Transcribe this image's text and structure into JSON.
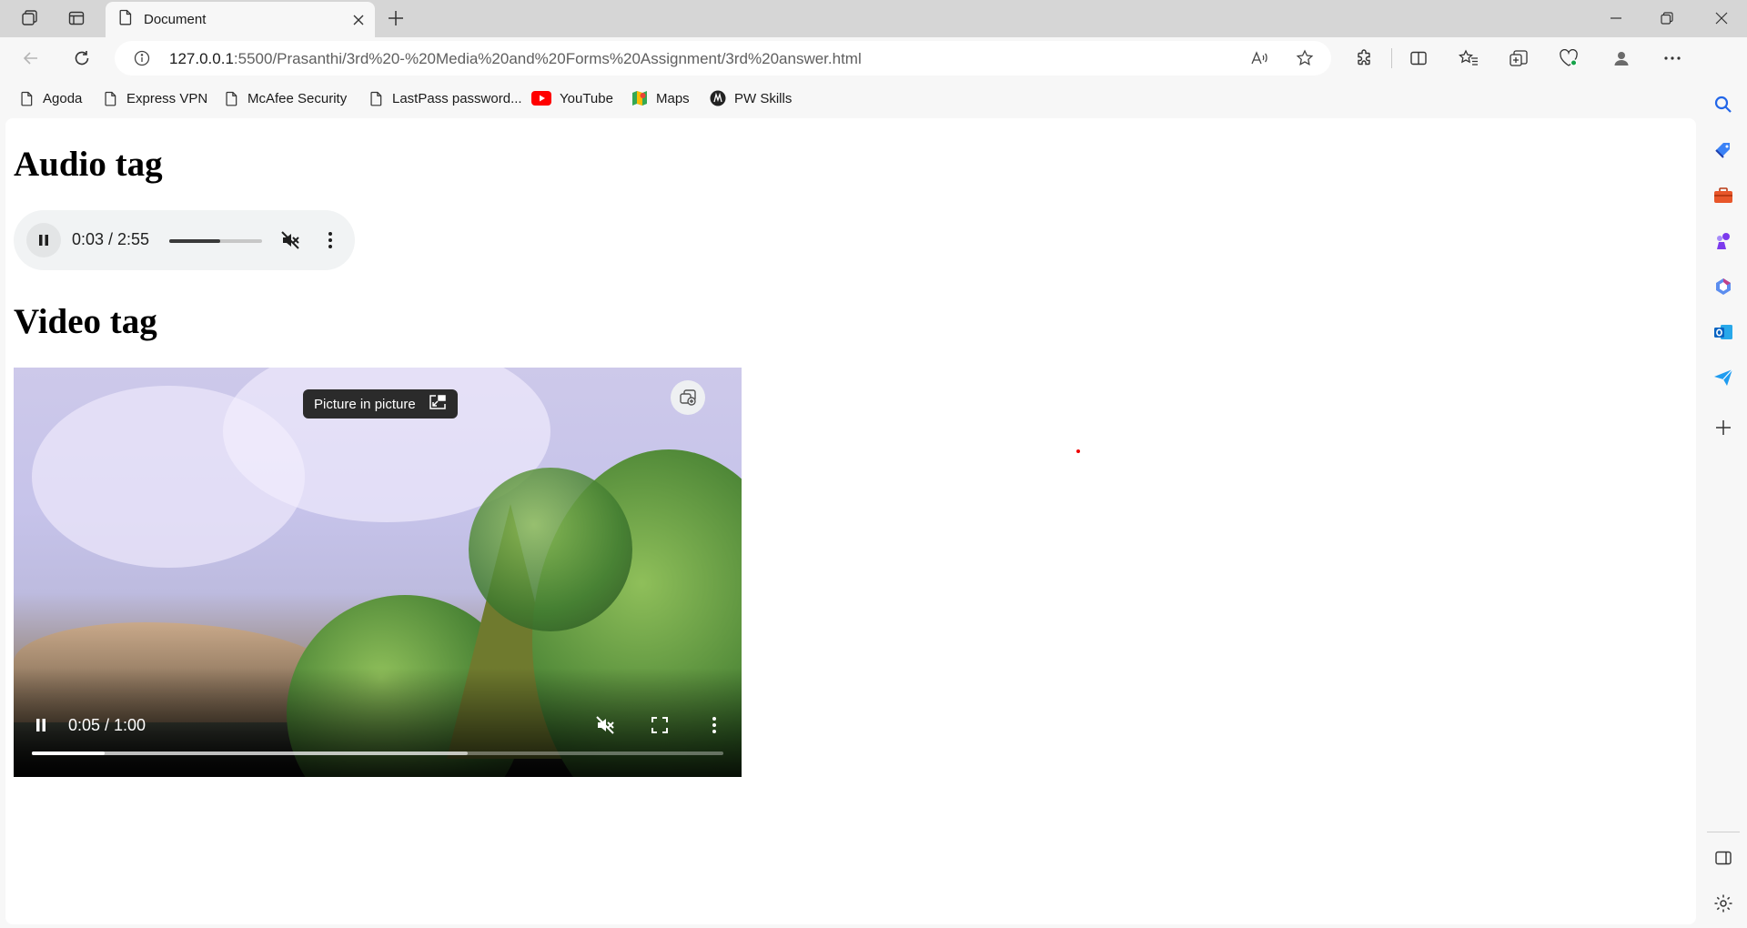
{
  "tab": {
    "title": "Document"
  },
  "address": {
    "host": "127.0.0.1",
    "path": ":5500/Prasanthi/3rd%20-%20Media%20and%20Forms%20Assignment/3rd%20answer.html"
  },
  "favorites": [
    {
      "label": "Agoda",
      "icon": "page-icon"
    },
    {
      "label": "Express VPN",
      "icon": "page-icon"
    },
    {
      "label": "McAfee Security",
      "icon": "page-icon"
    },
    {
      "label": "LastPass password...",
      "icon": "page-icon"
    },
    {
      "label": "YouTube",
      "icon": "youtube-icon"
    },
    {
      "label": "Maps",
      "icon": "maps-icon"
    },
    {
      "label": "PW Skills",
      "icon": "pw-skills-icon"
    }
  ],
  "page": {
    "audio_heading": "Audio tag",
    "video_heading": "Video tag"
  },
  "audio_player": {
    "time": "0:03 / 2:55",
    "volume_level": 0.55,
    "muted": true
  },
  "video_player": {
    "time": "0:05 / 1:00",
    "progress": 0.105,
    "buffered": 0.63,
    "muted": true,
    "pip_tooltip": "Picture in picture"
  },
  "colors": {
    "edge_accent": "#0078d4",
    "youtube_red": "#ff0000"
  }
}
